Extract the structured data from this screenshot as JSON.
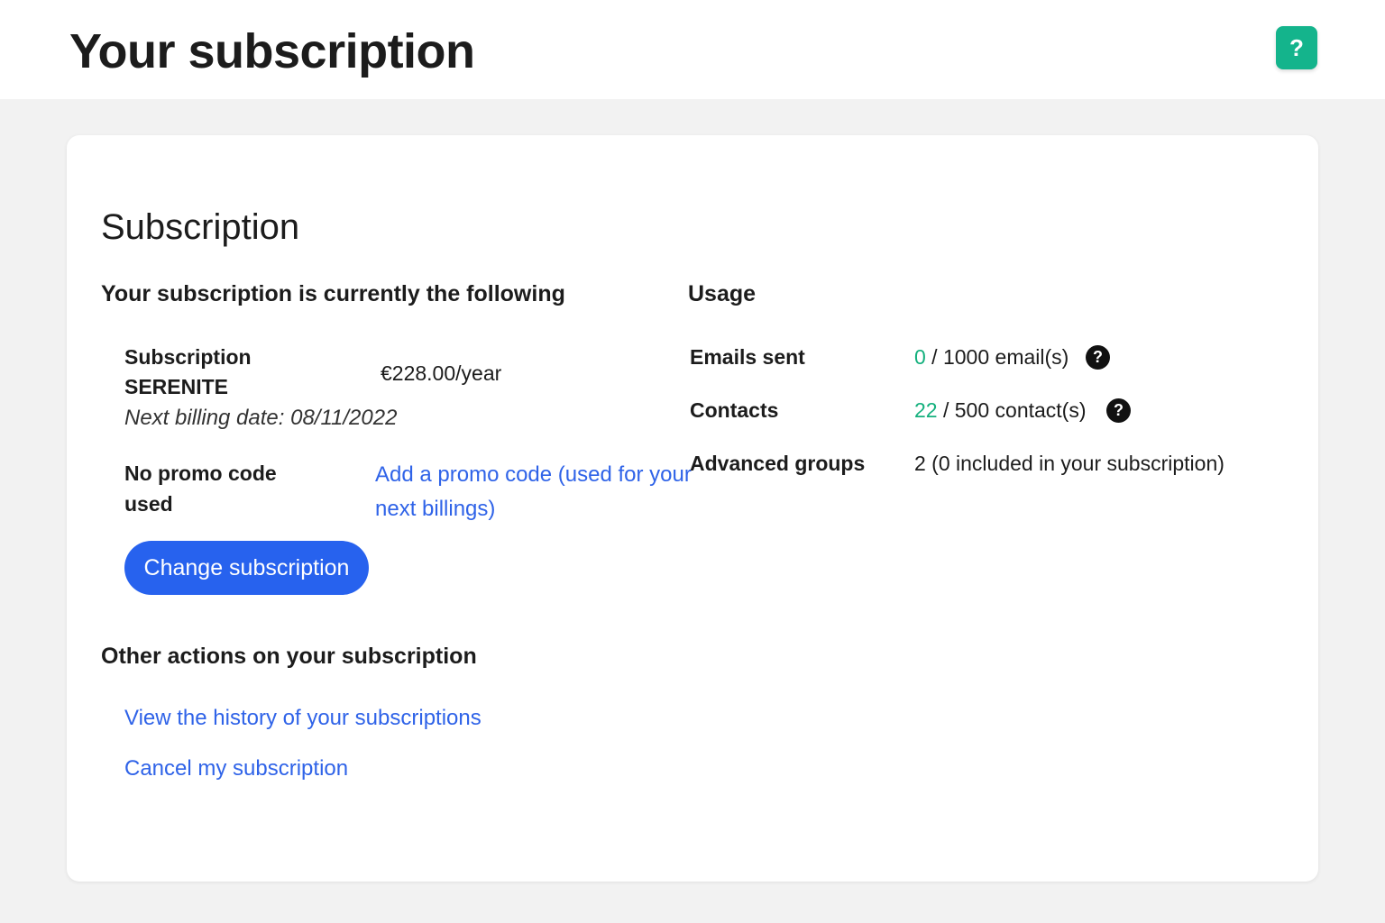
{
  "header": {
    "title": "Your subscription",
    "help_icon_glyph": "?"
  },
  "card": {
    "section_title": "Subscription",
    "current": {
      "heading": "Your subscription is currently the following",
      "plan_label_line1": "Subscription",
      "plan_label_line2": "SERENITE",
      "price": "€228.00/year",
      "next_billing": "Next billing date: 08/11/2022",
      "promo_label_line1": "No promo code",
      "promo_label_line2": "used",
      "promo_link_line1": "Add a promo code (used for your",
      "promo_link_line2": "next billings)",
      "change_button": "Change subscription"
    },
    "usage": {
      "heading": "Usage",
      "rows": [
        {
          "label": "Emails sent",
          "used": "0",
          "rest": " / 1000 email(s)"
        },
        {
          "label": "Contacts",
          "used": "22",
          "rest": " / 500 contact(s)"
        },
        {
          "label": "Advanced groups",
          "value": "2 (0 included in your subscription)"
        }
      ],
      "info_icon_glyph": "?"
    },
    "other": {
      "heading": "Other actions on your subscription",
      "history_link": "View the history of your subscriptions",
      "cancel_link": "Cancel my subscription"
    }
  },
  "colors": {
    "accent_green": "#14b48c",
    "usage_green": "#14b07d",
    "primary_blue": "#2762ee",
    "link_blue": "#2f63e8"
  }
}
